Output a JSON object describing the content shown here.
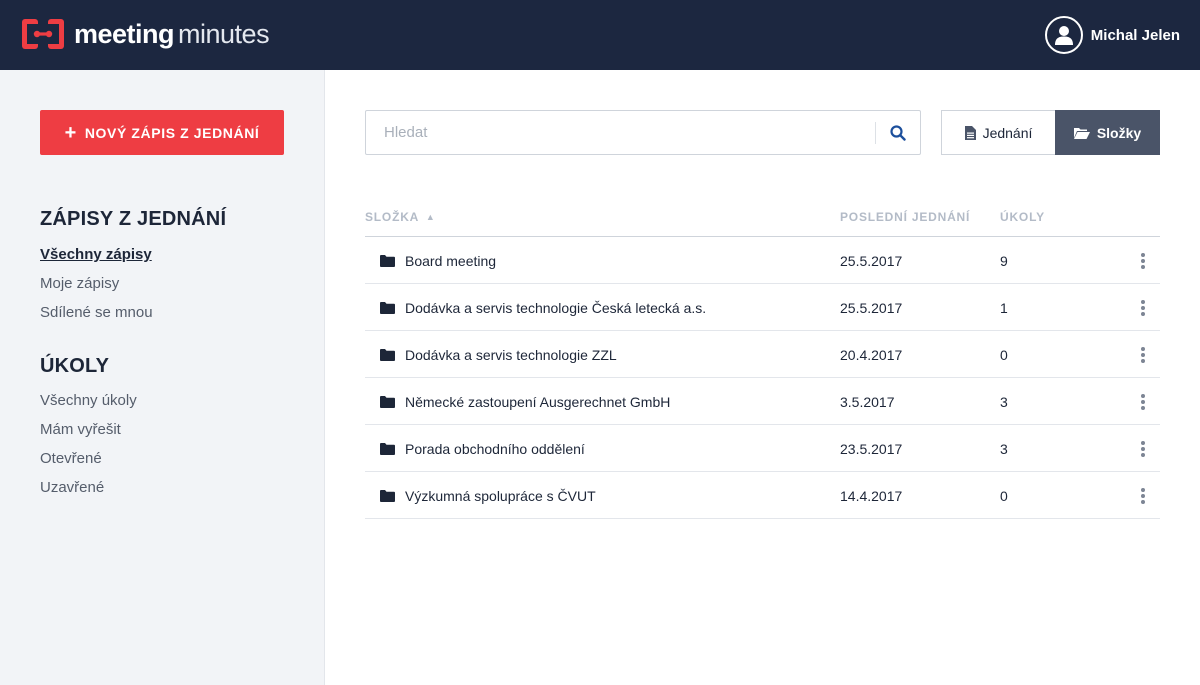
{
  "brand": {
    "word1": "meeting",
    "word2": "minutes"
  },
  "user": {
    "name": "Michal Jelen"
  },
  "sidebar": {
    "new_button": "NOVÝ ZÁPIS Z JEDNÁNÍ",
    "sections": [
      {
        "heading": "ZÁPISY Z JEDNÁNÍ",
        "items": [
          "Všechny zápisy",
          "Moje zápisy",
          "Sdílené se mnou"
        ],
        "active_index": 0
      },
      {
        "heading": "ÚKOLY",
        "items": [
          "Všechny úkoly",
          "Mám vyřešit",
          "Otevřené",
          "Uzavřené"
        ]
      }
    ]
  },
  "search": {
    "placeholder": "Hledat",
    "value": ""
  },
  "view_toggle": {
    "meetings_label": "Jednání",
    "folders_label": "Složky",
    "selected": "folders"
  },
  "table": {
    "columns": {
      "folder": "SLOŽKA",
      "last_meeting": "POSLEDNÍ JEDNÁNÍ",
      "tasks": "ÚKOLY"
    },
    "sort": {
      "column": "folder",
      "direction": "asc"
    },
    "rows": [
      {
        "folder": "Board meeting",
        "last_meeting": "25.5.2017",
        "tasks": "9"
      },
      {
        "folder": "Dodávka a servis technologie Česká letecká a.s.",
        "last_meeting": "25.5.2017",
        "tasks": "1"
      },
      {
        "folder": "Dodávka a servis technologie ZZL",
        "last_meeting": "20.4.2017",
        "tasks": "0"
      },
      {
        "folder": "Německé zastoupení Ausgerechnet GmbH",
        "last_meeting": "3.5.2017",
        "tasks": "3"
      },
      {
        "folder": "Porada obchodního oddělení",
        "last_meeting": "23.5.2017",
        "tasks": "3"
      },
      {
        "folder": "Výzkumná spolupráce s ČVUT",
        "last_meeting": "14.4.2017",
        "tasks": "0"
      }
    ]
  },
  "icons": {
    "logo": "meeting-minutes-logo",
    "user": "user-icon",
    "search": "search-icon",
    "meetings": "document-icon",
    "folders": "folder-open-icon",
    "row_folder": "folder-icon",
    "row_menu": "more-vertical-icon",
    "sort": "sort-asc-icon"
  },
  "colors": {
    "header_bg": "#1c2740",
    "accent_red": "#ee3d43",
    "sidebar_bg": "#f2f4f7",
    "toggle_active_bg": "#4a5468",
    "search_icon": "#1c4f9c"
  }
}
